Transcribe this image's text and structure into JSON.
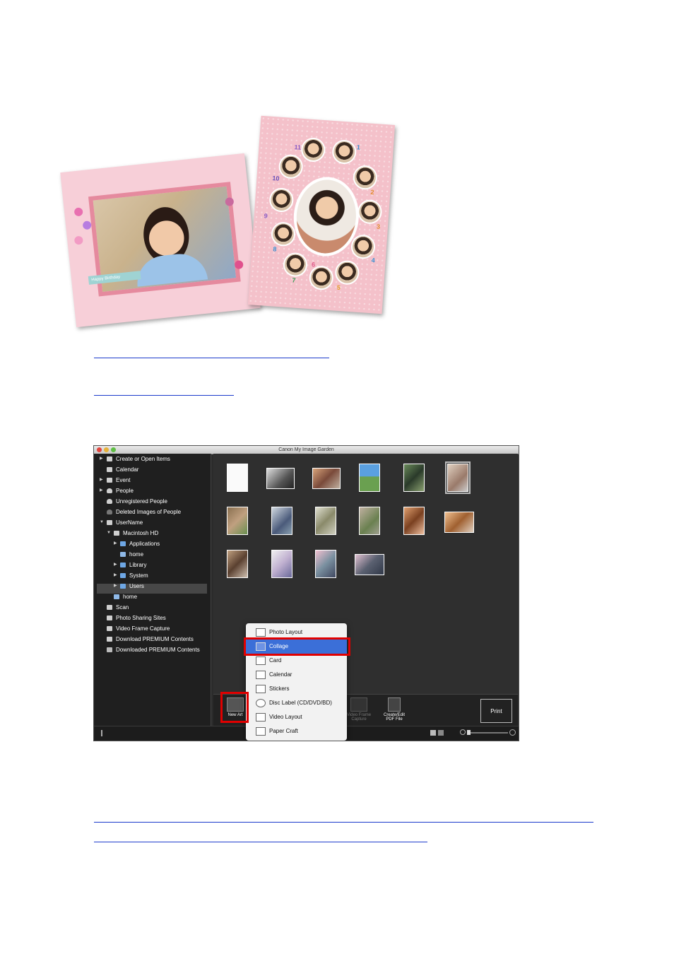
{
  "collage": {
    "caption": "Happy Birthday",
    "numbers": [
      "11",
      "1",
      "10",
      "2",
      "9",
      "3",
      "8",
      "4",
      "7",
      "6",
      "5"
    ]
  },
  "window": {
    "title": "Canon My Image Garden",
    "sidebar": [
      {
        "label": "Create or Open Items"
      },
      {
        "label": "Calendar"
      },
      {
        "label": "Event"
      },
      {
        "label": "People"
      },
      {
        "label": "Unregistered People"
      },
      {
        "label": "Deleted Images of People"
      },
      {
        "label": "UserName"
      },
      {
        "label": "Macintosh HD"
      },
      {
        "label": "Applications"
      },
      {
        "label": "home"
      },
      {
        "label": "Library"
      },
      {
        "label": "System"
      },
      {
        "label": "Users"
      },
      {
        "label": "home"
      },
      {
        "label": "Scan"
      },
      {
        "label": "Photo Sharing Sites"
      },
      {
        "label": "Video Frame Capture"
      },
      {
        "label": "Download PREMIUM Contents"
      },
      {
        "label": "Downloaded PREMIUM Contents"
      }
    ],
    "toolbar": {
      "new_art": "New Art",
      "video_frame": "Video Frame Capture",
      "create_pdf": "Create/Edit PDF File",
      "print": "Print"
    },
    "menu": [
      {
        "label": "Photo Layout"
      },
      {
        "label": "Collage"
      },
      {
        "label": "Card"
      },
      {
        "label": "Calendar"
      },
      {
        "label": "Stickers"
      },
      {
        "label": "Disc Label (CD/DVD/BD)"
      },
      {
        "label": "Video Layout"
      },
      {
        "label": "Paper Craft"
      }
    ]
  },
  "colors": {
    "link": "#1a3acb",
    "highlight": "#3b6fd8",
    "callout": "#e00000"
  }
}
